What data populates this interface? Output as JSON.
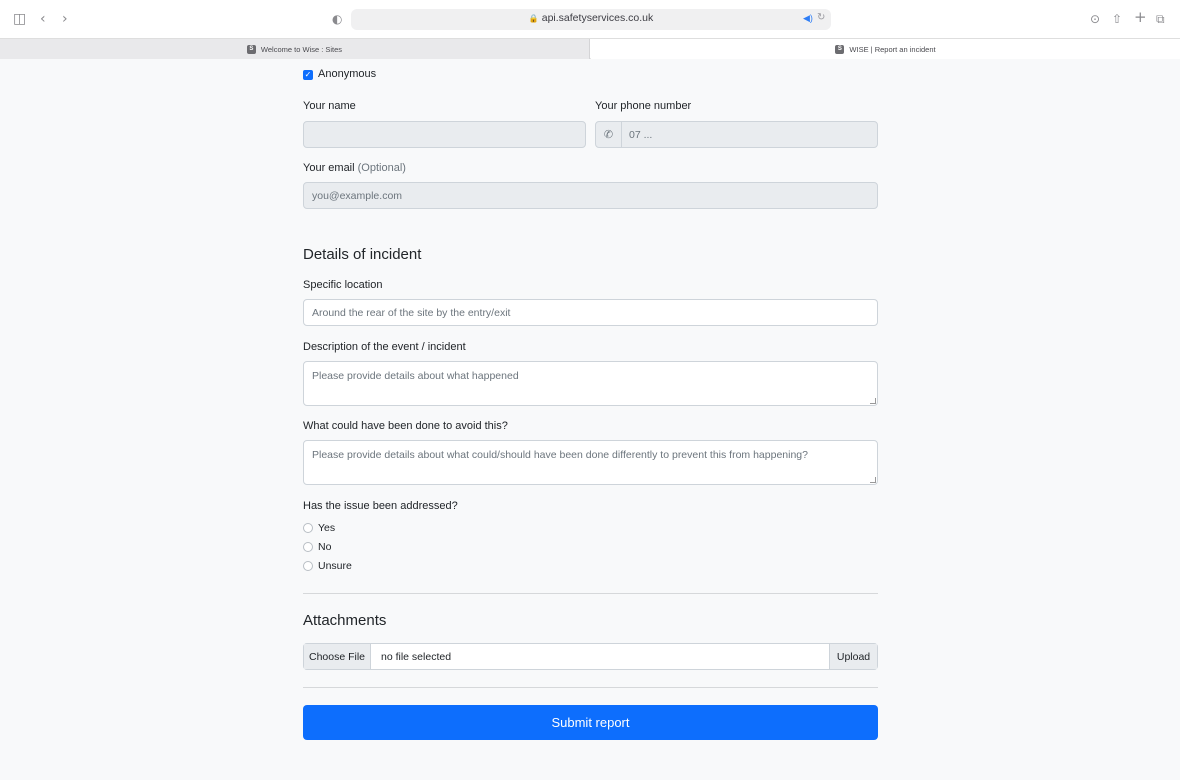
{
  "browser": {
    "url": "api.safetyservices.co.uk",
    "tabs": [
      {
        "label": "Welcome to Wise : Sites",
        "favicon": "S"
      },
      {
        "label": "WISE | Report an incident",
        "favicon": "S"
      }
    ]
  },
  "form": {
    "anonymous_label": "Anonymous",
    "anonymous_checked": true,
    "name_label": "Your name",
    "name_value": "",
    "phone_label": "Your phone number",
    "phone_placeholder": "07 ...",
    "email_label": "Your email",
    "email_optional": "(Optional)",
    "email_placeholder": "you@example.com",
    "details_heading": "Details of incident",
    "location_label": "Specific location",
    "location_placeholder": "Around the rear of the site by the entry/exit",
    "description_label": "Description of the event / incident",
    "description_placeholder": "Please provide details about what happened",
    "avoid_label": "What could have been done to avoid this?",
    "avoid_placeholder": "Please provide details about what could/should have been done differently to prevent this from happening?",
    "addressed_label": "Has the issue been addressed?",
    "addressed_options": [
      "Yes",
      "No",
      "Unsure"
    ],
    "attachments_heading": "Attachments",
    "choose_file_label": "Choose File",
    "file_status": "no file selected",
    "upload_label": "Upload",
    "submit_label": "Submit report"
  },
  "colors": {
    "primary": "#0d6efd",
    "page_bg": "#f8f9fa",
    "disabled_bg": "#e9ecef"
  }
}
